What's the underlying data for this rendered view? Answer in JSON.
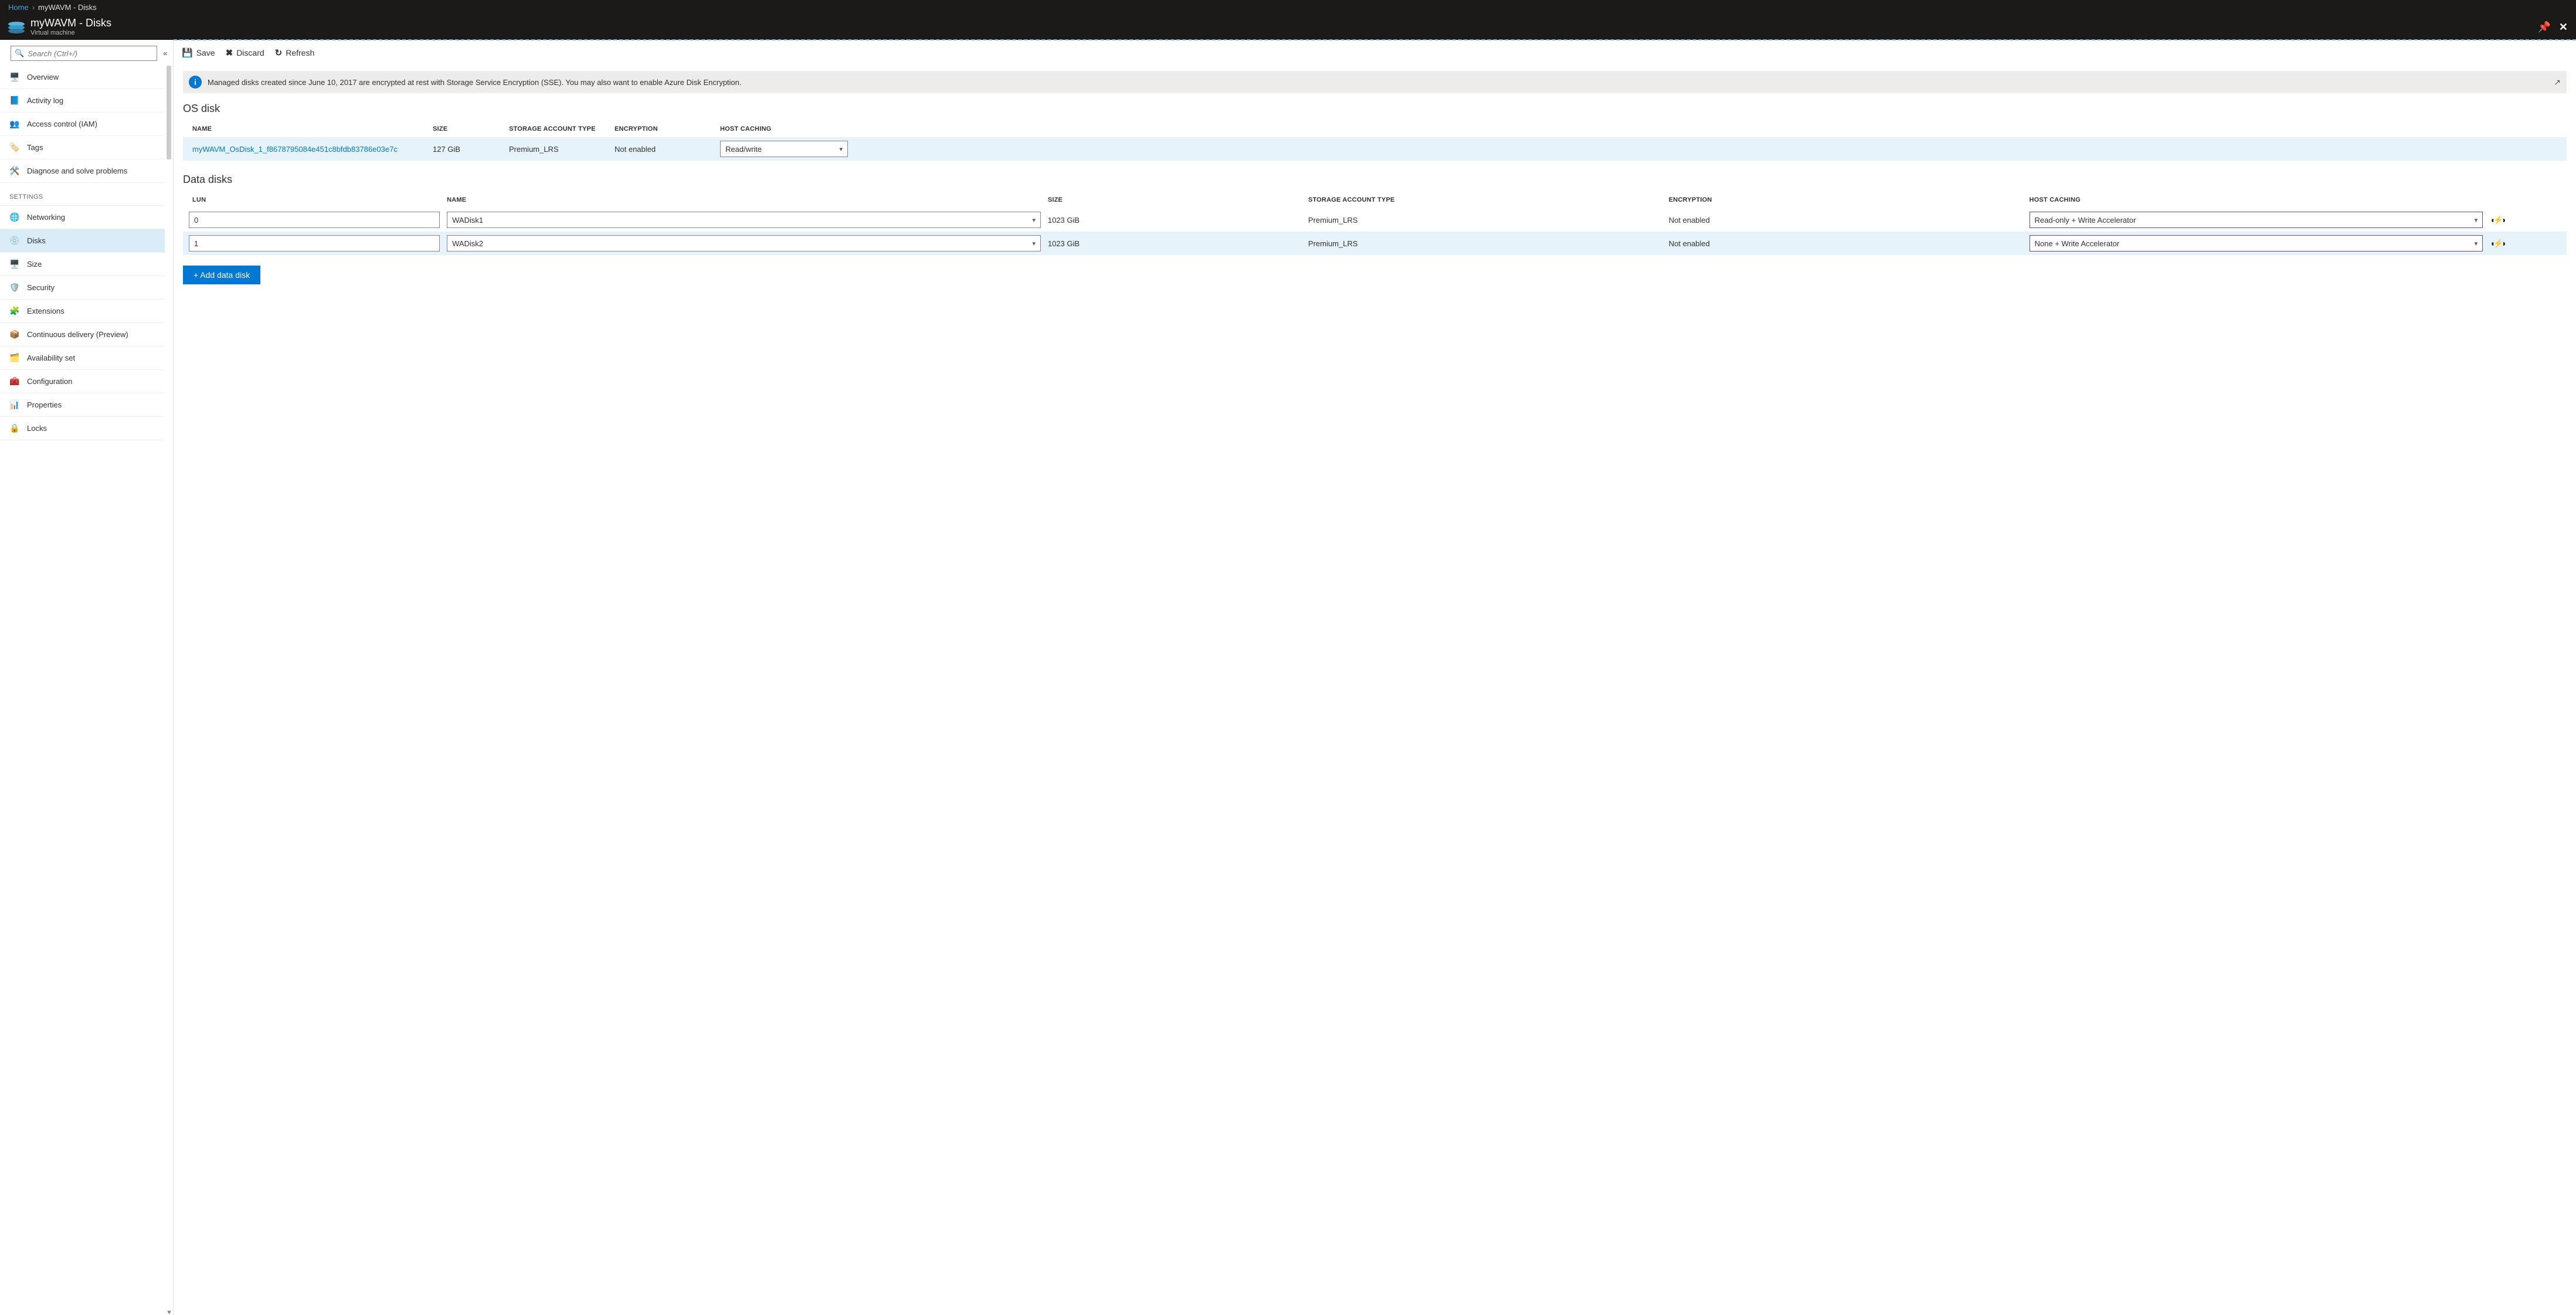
{
  "breadcrumb": {
    "home": "Home",
    "current": "myWAVM - Disks"
  },
  "header": {
    "title": "myWAVM - Disks",
    "subtitle": "Virtual machine"
  },
  "search": {
    "placeholder": "Search (Ctrl+/)"
  },
  "nav": {
    "top": [
      {
        "label": "Overview"
      },
      {
        "label": "Activity log"
      },
      {
        "label": "Access control (IAM)"
      },
      {
        "label": "Tags"
      },
      {
        "label": "Diagnose and solve problems"
      }
    ],
    "settings_hdr": "SETTINGS",
    "settings": [
      {
        "label": "Networking"
      },
      {
        "label": "Disks"
      },
      {
        "label": "Size"
      },
      {
        "label": "Security"
      },
      {
        "label": "Extensions"
      },
      {
        "label": "Continuous delivery (Preview)"
      },
      {
        "label": "Availability set"
      },
      {
        "label": "Configuration"
      },
      {
        "label": "Properties"
      },
      {
        "label": "Locks"
      }
    ]
  },
  "toolbar": {
    "save": "Save",
    "discard": "Discard",
    "refresh": "Refresh"
  },
  "notice": "Managed disks created since June 10, 2017 are encrypted at rest with Storage Service Encryption (SSE). You may also want to enable Azure Disk Encryption.",
  "os_section": "OS disk",
  "data_section": "Data disks",
  "cols": {
    "lun": "LUN",
    "name": "NAME",
    "size": "SIZE",
    "sat": "STORAGE ACCOUNT TYPE",
    "enc": "ENCRYPTION",
    "hc": "HOST CACHING"
  },
  "os_disk": {
    "name": "myWAVM_OsDisk_1_f8678795084e451c8bfdb83786e03e7c",
    "size": "127 GiB",
    "sat": "Premium_LRS",
    "enc": "Not enabled",
    "hc": "Read/write"
  },
  "data_disks": [
    {
      "lun": "0",
      "name": "WADisk1",
      "size": "1023 GiB",
      "sat": "Premium_LRS",
      "enc": "Not enabled",
      "hc": "Read-only + Write Accelerator"
    },
    {
      "lun": "1",
      "name": "WADisk2",
      "size": "1023 GiB",
      "sat": "Premium_LRS",
      "enc": "Not enabled",
      "hc": "None + Write Accelerator"
    }
  ],
  "add_btn": "+ Add data disk"
}
